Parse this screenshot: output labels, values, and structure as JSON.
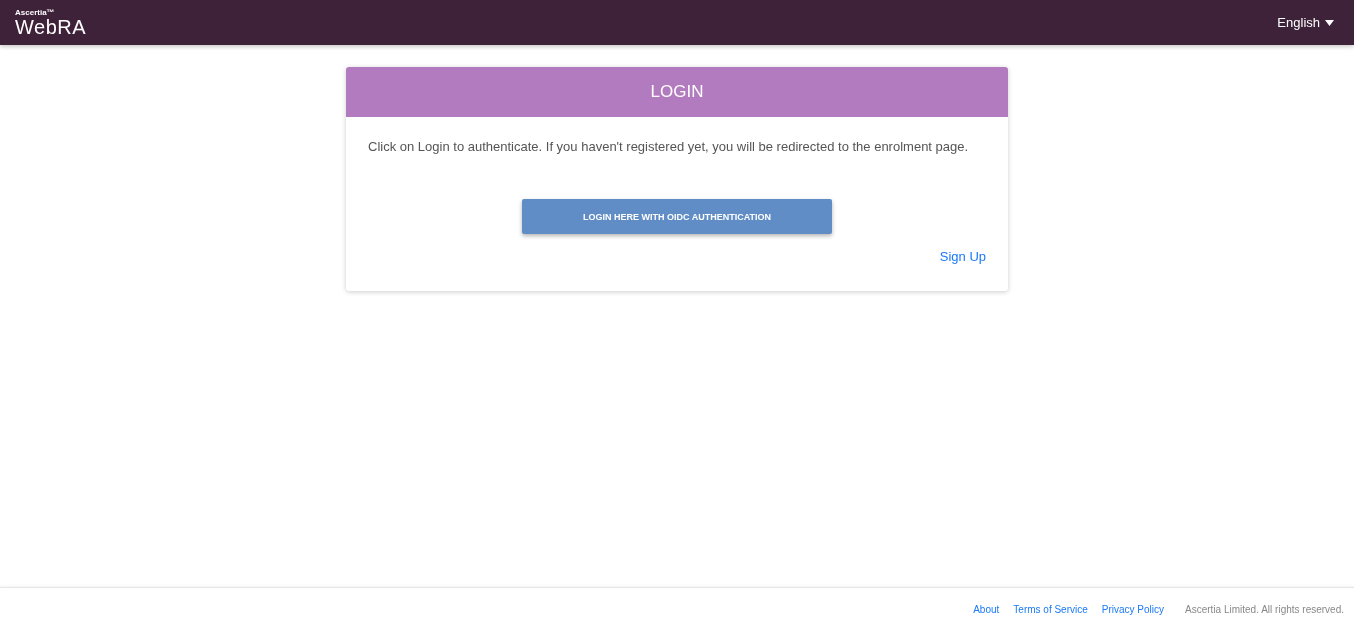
{
  "header": {
    "logo_small": "Ascertia™",
    "logo": "WebRA",
    "language": "English"
  },
  "login": {
    "title": "LOGIN",
    "message": "Click on Login to authenticate. If you haven't registered yet, you will be redirected to the enrolment page.",
    "button": "LOGIN HERE WITH OIDC AUTHENTICATION",
    "signup": "Sign Up"
  },
  "footer": {
    "links": [
      "About",
      "Terms of Service",
      "Privacy Policy"
    ],
    "copyright": "Ascertia Limited. All rights reserved."
  }
}
